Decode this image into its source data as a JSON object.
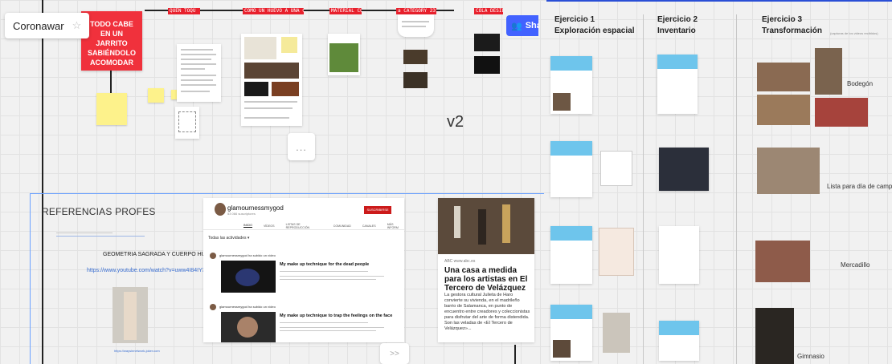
{
  "board": {
    "title": "Coronawar"
  },
  "toolbar": {
    "share_label": "Sha"
  },
  "sticky": {
    "red_note": "TODO CABE EN UN JARRITO SABIÉNDOLO ACOMODAR"
  },
  "tags": [
    "QUEN TOQU",
    "COMO UN HUEVO A UNA CASTAÑA",
    "MATERIAL COLE",
    "a CATEGORY 23",
    "COLA DESIERTA"
  ],
  "canvas": {
    "version_label": "v2",
    "more_label": "...",
    "next_label": ">>"
  },
  "references": {
    "title": "REFERENCIAS PROFES",
    "geometry_label": "GEOMETRIA SAGRADA Y CUERPO HUMANO",
    "youtube_link": "https://www.youtube.com/watch?v=uww4I84IY3w",
    "small_link": "https://waysinnetwork-joker.com"
  },
  "youtube_panel": {
    "channel_name": "glamournessmygod",
    "subscribers": "53 066 suscriptores",
    "subscribe_label": "SUSCRIBIRSE",
    "tabs": [
      "INICIO",
      "VÍDEOS",
      "LISTAS DE REPRODUCCIÓN",
      "COMUNIDAD",
      "CANALES",
      "MÁS INFORM"
    ],
    "activity_filter": "Todas las actividades ▾",
    "videos": [
      {
        "user": "glamournessmygod ha subido un vídeo",
        "title": "My make up technique for the dead people"
      },
      {
        "user": "glamournessmygod ha subido un vídeo",
        "title": "My make up technique to trap the feelings on the face"
      }
    ]
  },
  "article": {
    "source": "ABC   www.abc.es",
    "title": "Una casa a medida para los artistas en El Tercero de Velázquez",
    "body": "La gestora cultural Julieta de Haro convierte su vivienda, en el madrileño barrio de Salamanca, en punto de encuentro entre creadores y coleccionistas para disfrutar del arte de forma distendida. Son las veladas de «El Tercero de Velázquez»..."
  },
  "exercises": [
    {
      "title_line1": "Ejercicio 1",
      "title_line2": "Exploración espacial"
    },
    {
      "title_line1": "Ejercicio 2",
      "title_line2": "Inventario"
    },
    {
      "title_line1": "Ejercicio 3",
      "title_line2": "Transformación",
      "note": "(capturas de los videos recibidos)"
    }
  ],
  "transform_labels": [
    "Bodegón",
    "Lista para día de campo",
    "Mercadillo",
    "Gimnasio"
  ],
  "colors": {
    "accent_blue": "#4262ff",
    "sticky_red": "#f0313c",
    "sticky_yellow": "#fdf28b",
    "sheet_blue": "#6ec5ec"
  }
}
